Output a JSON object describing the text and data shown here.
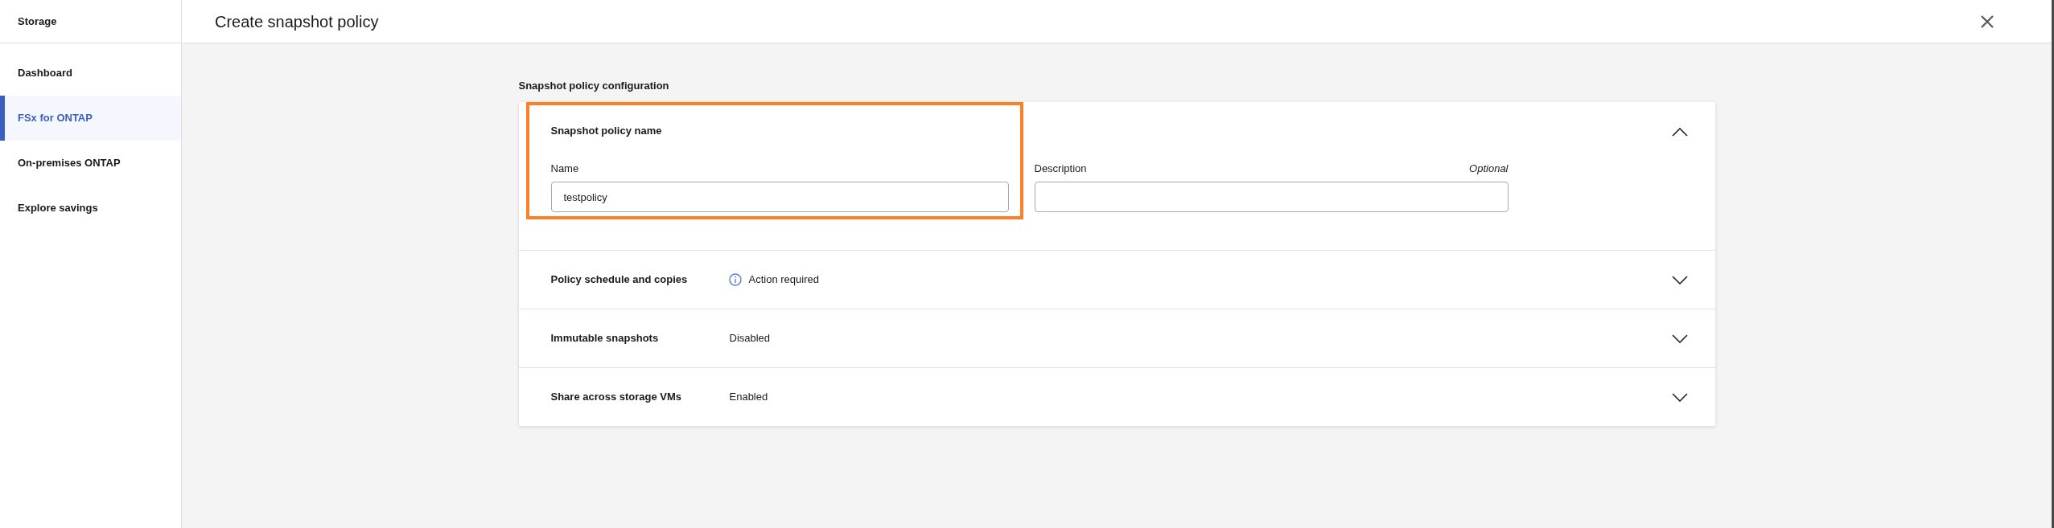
{
  "sidebar": {
    "title": "Storage",
    "items": [
      {
        "label": "Dashboard",
        "selected": false
      },
      {
        "label": "FSx for ONTAP",
        "selected": true
      },
      {
        "label": "On-premises ONTAP",
        "selected": false
      },
      {
        "label": "Explore savings",
        "selected": false
      }
    ]
  },
  "header": {
    "title": "Create snapshot policy"
  },
  "form": {
    "title": "Snapshot policy configuration",
    "sections": [
      {
        "title": "Snapshot policy name",
        "expanded": true,
        "highlighted": true,
        "fields": [
          {
            "label": "Name",
            "value": "testpolicy"
          },
          {
            "label": "Description",
            "hint": "Optional"
          }
        ]
      },
      {
        "title": "Policy schedule and copies",
        "expanded": false,
        "highlighted": false,
        "status": {
          "kind": "info",
          "text": "Action required"
        }
      },
      {
        "title": "Immutable snapshots",
        "expanded": false,
        "highlighted": false,
        "status": {
          "kind": "plain",
          "text": "Disabled"
        }
      },
      {
        "title": "Share across storage VMs",
        "expanded": false,
        "highlighted": false,
        "status": {
          "kind": "plain",
          "text": "Enabled"
        }
      }
    ]
  }
}
